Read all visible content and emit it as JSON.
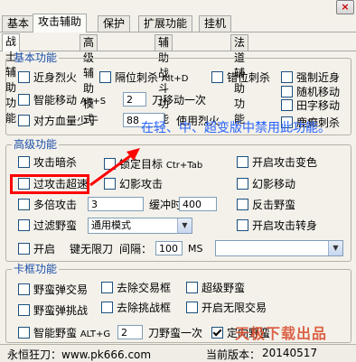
{
  "close_label": "×",
  "tabs_top": [
    "基本",
    "攻击辅助",
    "保护",
    "扩展功能",
    "挂机"
  ],
  "tabs_sub": [
    "战士辅助功能",
    "高级辅助模式",
    "辅助战斗功能",
    "法道辅助功能"
  ],
  "basic": {
    "title": "基本功能",
    "items": [
      {
        "label": "近身烈火",
        "checked": false
      },
      {
        "label": "隔位刺杀",
        "hint": "Alt+D",
        "checked": false
      },
      {
        "label": "错位刺杀",
        "checked": false
      },
      {
        "label": "强制近身",
        "checked": false
      },
      {
        "label": "随机移动",
        "checked": false
      },
      {
        "label": "田字移动",
        "checked": false
      },
      {
        "label": "智能移动",
        "hint": "Alt+S",
        "checked": false
      },
      {
        "label": "刀移动一次",
        "value": "2"
      },
      {
        "label": "对方血量少于",
        "checked": false
      },
      {
        "label": "使用烈火",
        "value": "88"
      },
      {
        "label": "鹿癫刺杀",
        "checked": false
      }
    ]
  },
  "advanced": {
    "title": "高级功能",
    "attack_hide": "攻击暗杀",
    "lock_target": "锁定目标",
    "lock_hint": "Ctr+Tab",
    "attack_color": "开启攻击变色",
    "attack_speed": "过攻击超速",
    "phantom_attack": "幻影攻击",
    "phantom_move": "幻影移动",
    "multi_attack": "多倍攻击",
    "multi_value": "3",
    "buffer_label": "缓冲时间",
    "buffer_value": "400",
    "counter_bull": "反击野蛮",
    "filter_bull": "过滤野蛮",
    "filter_mode": "通用模式",
    "attack_turn": "开启攻击转身",
    "open_key": "开启",
    "open_key2": "键无限刀",
    "interval_label": "间隔：",
    "interval_value": "100",
    "interval_unit": "MS"
  },
  "stuck": {
    "title": "卡框功能",
    "bull_trade": "野蛮弹交易",
    "remove_trade": "去除交易框",
    "super_bull": "超级野蛮",
    "bull_challenge": "野蛮弹挑战",
    "remove_challenge": "去除挑战框",
    "open_unlimited_trade": "开启无限交易",
    "smart_bull": "智能野蛮",
    "smart_hint": "ALT+G",
    "bull_value": "2",
    "bull_once": "刀野蛮一次",
    "fixed_bull": "定向野蛮",
    "fixed_checked": true
  },
  "annotation": {
    "note": "在轻、中、超变版中禁用此功能。"
  },
  "footer": {
    "left": "永恒狂刀：www.pk666.com",
    "right_label": "当前版本：",
    "right_value": "20140517"
  },
  "watermark": "天极下载出品",
  "colors": {
    "group_title": "#1c4ea8",
    "annotation": "#2a64ff",
    "highlight_box": "#ff0000",
    "background": "#f3f1ea"
  }
}
